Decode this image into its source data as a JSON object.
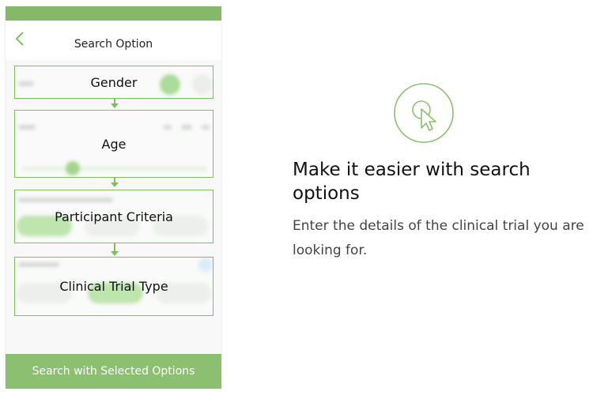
{
  "phone": {
    "title": "Search Option",
    "sections": [
      {
        "label": "Gender"
      },
      {
        "label": "Age"
      },
      {
        "label": "Participant Criteria"
      },
      {
        "label": "Clinical Trial Type"
      }
    ],
    "search_button_label": "Search with Selected Options"
  },
  "info": {
    "title": "Make it easier with search options",
    "description": "Enter the details of the clinical trial you are looking for."
  },
  "colors": {
    "accent": "#85b969",
    "button": "#8cc070",
    "box_border": "#7cc15a"
  },
  "icons": {
    "back": "chevron-left-icon",
    "cursor": "pointer-click-icon"
  }
}
